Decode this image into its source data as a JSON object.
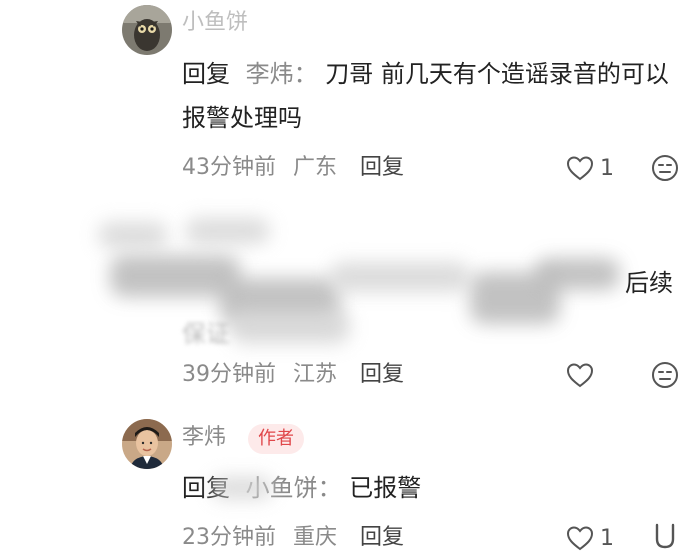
{
  "comments": [
    {
      "username": "小鱼饼",
      "reply_prefix": "回复",
      "reply_to": "李炜：",
      "text": "刀哥 前几天有个造谣录音的可以报警处理吗",
      "time": "43分钟前",
      "location": "广东",
      "reply_label": "回复",
      "like_count": "1",
      "avatar_icon": "owl-avatar"
    },
    {
      "username": "",
      "text_visible_end": "后续",
      "text_line2_start": "保证",
      "time": "39分钟前",
      "location": "江苏",
      "reply_label": "回复",
      "like_count": "",
      "obscured": true
    },
    {
      "username": "李炜",
      "author_badge": "作者",
      "reply_prefix": "回复",
      "reply_to": "小鱼饼：",
      "text": "已报警",
      "time": "23分钟前",
      "location": "重庆",
      "reply_label": "回复",
      "like_count": "1",
      "avatar_icon": "man-avatar"
    }
  ],
  "colors": {
    "secondary_text": "#8a8a8a",
    "primary_text": "#222222",
    "author_badge_bg": "#fdeaea",
    "author_badge_text": "#e0474a"
  },
  "icons": [
    "heart-icon",
    "dislike-face-icon"
  ]
}
